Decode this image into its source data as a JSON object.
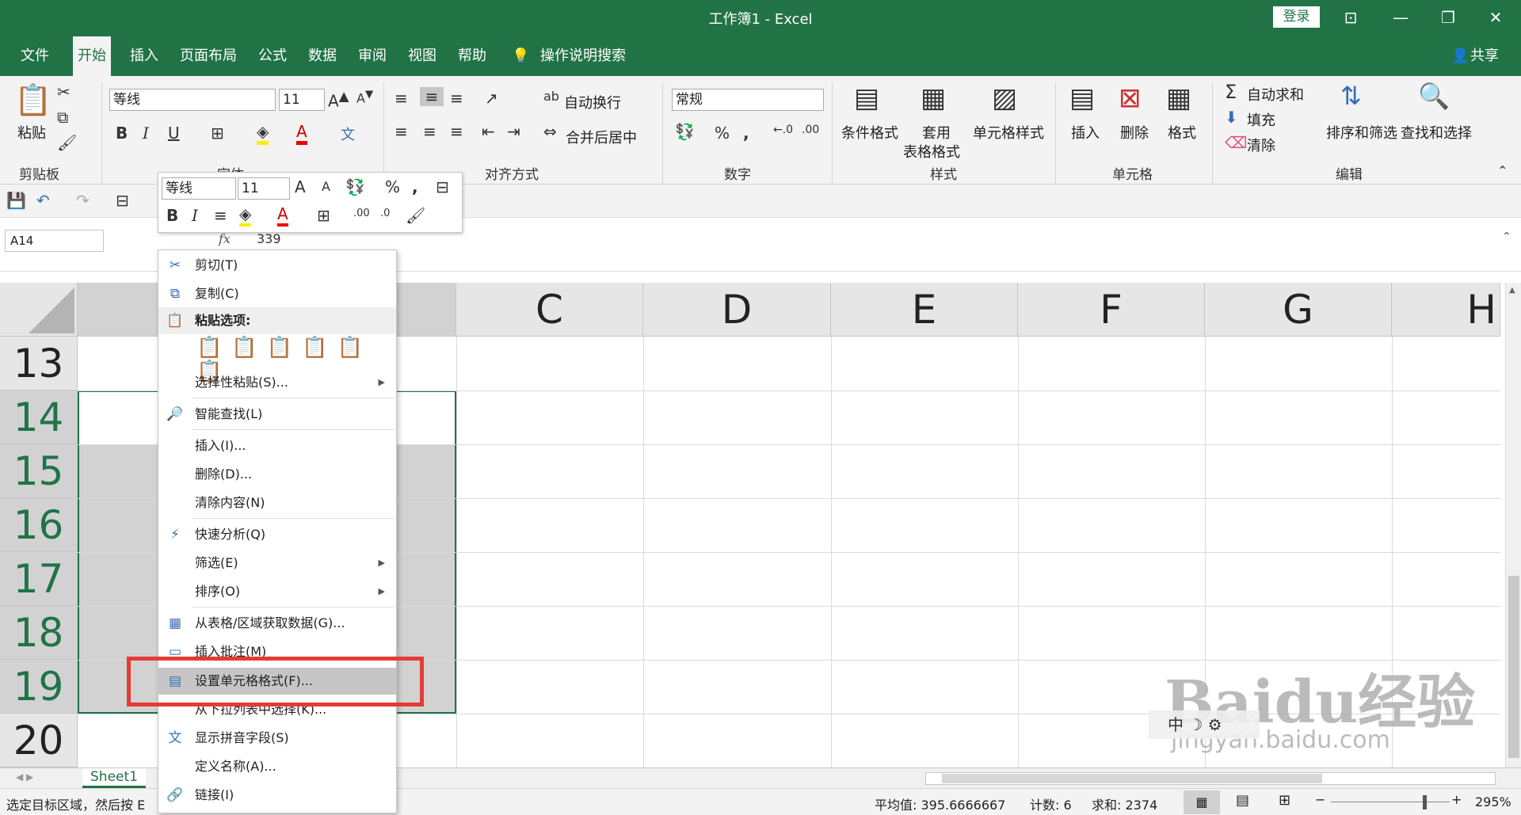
{
  "title_bar": {
    "title": "工作簿1  -  Excel",
    "login": "登录",
    "ribbon_display": "⊡",
    "minimize": "—",
    "restore": "❐",
    "close": "✕"
  },
  "menu_tabs": [
    "文件",
    "开始",
    "插入",
    "页面布局",
    "公式",
    "数据",
    "审阅",
    "视图",
    "帮助"
  ],
  "tell_me": "操作说明搜索",
  "share": "共享",
  "ribbon": {
    "clipboard": {
      "group": "剪贴板",
      "paste": "粘贴"
    },
    "font": {
      "group": "字体",
      "name": "等线",
      "size": "11"
    },
    "alignment": {
      "group": "对齐方式",
      "wrap": "自动换行",
      "merge": "合并后居中"
    },
    "number": {
      "group": "数字",
      "format": "常规"
    },
    "styles": {
      "group": "样式",
      "conditional": "条件格式",
      "table_fmt_1": "套用",
      "table_fmt_2": "表格格式",
      "cell_styles": "单元格样式"
    },
    "cells": {
      "group": "单元格",
      "insert": "插入",
      "delete": "删除",
      "format": "格式"
    },
    "editing": {
      "group": "编辑",
      "autosum": "自动求和",
      "fill": "填充",
      "clear": "清除",
      "sort_filter": "排序和筛选",
      "find_select": "查找和选择"
    }
  },
  "formula_bar": {
    "name_box": "A14",
    "fx": "fx",
    "value": "339"
  },
  "mini_toolbar": {
    "font": "等线",
    "size": "11"
  },
  "columns": [
    "C",
    "D",
    "E",
    "F",
    "G",
    "H"
  ],
  "rows": [
    "13",
    "14",
    "15",
    "16",
    "17",
    "18",
    "19",
    "20"
  ],
  "context_menu": {
    "cut": "剪切(T)",
    "copy": "复制(C)",
    "paste_options": "粘贴选项:",
    "paste_special": "选择性粘贴(S)...",
    "smart_lookup": "智能查找(L)",
    "insert": "插入(I)...",
    "delete": "删除(D)...",
    "clear": "清除内容(N)",
    "quick_analysis": "快速分析(Q)",
    "filter": "筛选(E)",
    "sort": "排序(O)",
    "get_data": "从表格/区域获取数据(G)...",
    "insert_comment": "插入批注(M)",
    "format_cells": "设置单元格格式(F)...",
    "pick_from_list": "从下拉列表中选择(K)...",
    "phonetic": "显示拼音字段(S)",
    "define_name": "定义名称(A)...",
    "link": "链接(I)"
  },
  "sheet_tab": "Sheet1",
  "status": {
    "message": "选定目标区域，然后按 E",
    "average": "平均值: 395.6666667",
    "count": "计数: 6",
    "sum": "求和: 2374",
    "zoom": "295%"
  },
  "ime": "中",
  "watermark": {
    "brand": "Baidu经验",
    "url": "jingyan.baidu.com"
  },
  "colors": {
    "excel_green": "#217346",
    "highlight_red": "#e43b35"
  }
}
